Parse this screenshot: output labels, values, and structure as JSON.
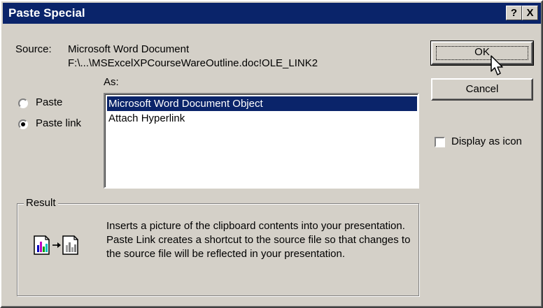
{
  "dialog": {
    "title": "Paste Special",
    "help_button": "?",
    "close_button": "X"
  },
  "source": {
    "label": "Source:",
    "document": "Microsoft Word Document",
    "path": "F:\\...\\MSExcelXPCourseWareOutline.doc!OLE_LINK2"
  },
  "as_label": "As:",
  "options": {
    "paste": {
      "label": "Paste",
      "selected": false
    },
    "paste_link": {
      "label": "Paste link",
      "selected": true
    }
  },
  "list": {
    "items": [
      "Microsoft Word Document Object",
      "Attach Hyperlink"
    ],
    "selected_index": 0
  },
  "buttons": {
    "ok": "OK",
    "cancel": "Cancel"
  },
  "display_as_icon": {
    "label": "Display as icon",
    "checked": false
  },
  "result": {
    "label": "Result",
    "text": "Inserts a picture of the clipboard contents into your presentation. Paste Link creates a shortcut to the source file so that changes to the source file will be reflected in your presentation."
  },
  "colors": {
    "title_bar": "#0a246a",
    "selection": "#0a246a",
    "face": "#d4d0c8"
  },
  "icons": [
    "question-icon",
    "close-icon",
    "result-paste-link-icon",
    "mouse-pointer-icon"
  ]
}
